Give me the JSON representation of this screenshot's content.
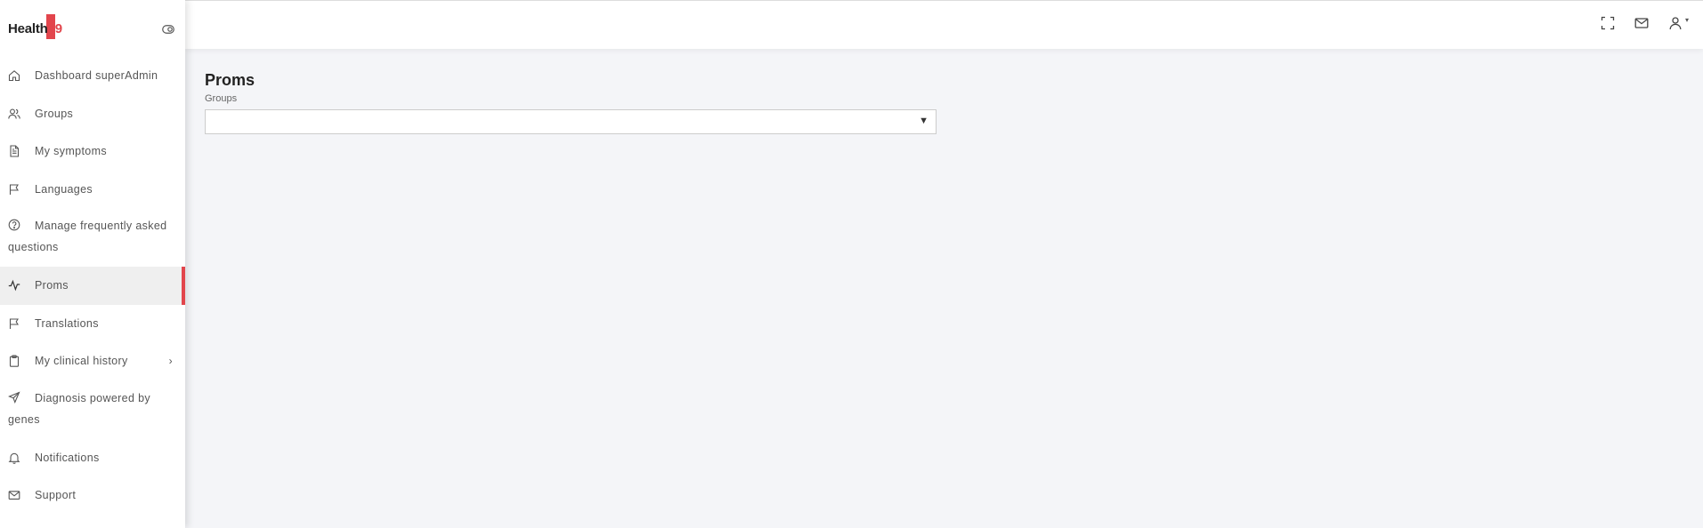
{
  "brand": {
    "name": "Health",
    "number": "29"
  },
  "sidebar": {
    "items": [
      {
        "label": "Dashboard superAdmin",
        "icon": "home-icon"
      },
      {
        "label": "Groups",
        "icon": "users-icon"
      },
      {
        "label": "My symptoms",
        "icon": "document-icon"
      },
      {
        "label": "Languages",
        "icon": "flag-icon"
      },
      {
        "label": "Manage frequently asked questions",
        "icon": "help-circle-icon"
      },
      {
        "label": "Proms",
        "icon": "activity-icon",
        "active": true
      },
      {
        "label": "Translations",
        "icon": "flag-icon"
      },
      {
        "label": "My clinical history",
        "icon": "clipboard-icon",
        "chevron": "›"
      },
      {
        "label": "Diagnosis powered by genes",
        "icon": "send-icon"
      },
      {
        "label": "Notifications",
        "icon": "bell-icon"
      },
      {
        "label": "Support",
        "icon": "mail-icon"
      }
    ]
  },
  "topbar": {
    "icons": [
      "fullscreen-icon",
      "mail-icon",
      "user-icon"
    ],
    "user_caret": "▾"
  },
  "main": {
    "title": "Proms",
    "groups_label": "Groups",
    "groups_value": "",
    "select_arrow": "▼"
  },
  "colors": {
    "accent": "#e2454c",
    "background": "#f4f5f8",
    "active_item_bg": "#efefef"
  }
}
